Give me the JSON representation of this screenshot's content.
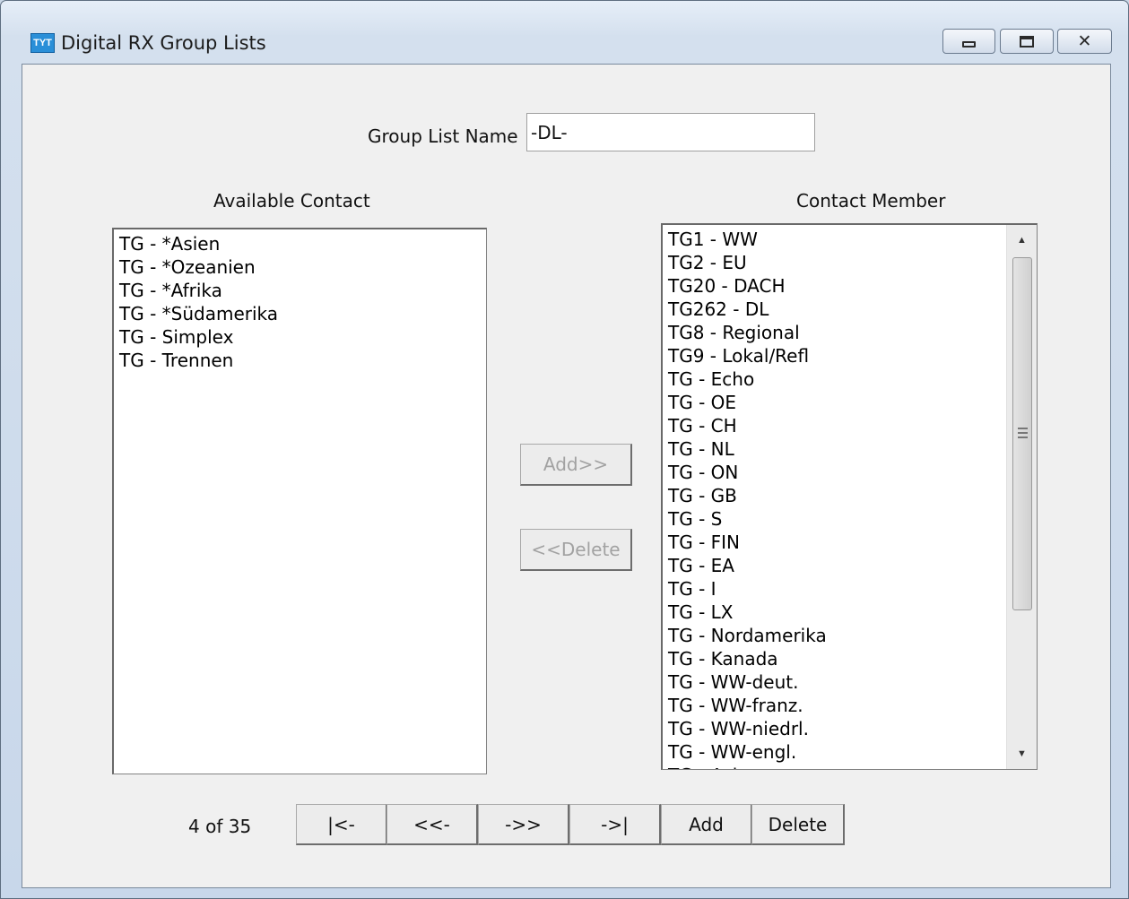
{
  "window": {
    "title": "Digital RX Group Lists",
    "app_icon_text": "TYT",
    "controls": [
      "minimize-icon",
      "maximize-icon",
      "close-icon"
    ]
  },
  "group_list_name": {
    "label": "Group List Name",
    "value": "-DL-"
  },
  "available": {
    "label": "Available Contact",
    "items": [
      "TG - *Asien",
      "TG - *Ozeanien",
      "TG - *Afrika",
      "TG - *Südamerika",
      "TG - Simplex",
      "TG - Trennen"
    ]
  },
  "member": {
    "label": "Contact Member",
    "items": [
      "TG1 - WW",
      "TG2 - EU",
      "TG20 - DACH",
      "TG262 - DL",
      "TG8 - Regional",
      "TG9 - Lokal/Refl",
      "TG - Echo",
      "TG - OE",
      "TG - CH",
      "TG - NL",
      "TG - ON",
      "TG - GB",
      "TG - S",
      "TG - FIN",
      "TG - EA",
      "TG - I",
      "TG - LX",
      "TG - Nordamerika",
      "TG - Kanada",
      "TG - WW-deut.",
      "TG - WW-franz.",
      "TG - WW-niedrl.",
      "TG - WW-engl.",
      "TG - Asien"
    ]
  },
  "transfer": {
    "add_label": "Add>>",
    "delete_label": "<<Delete"
  },
  "navigation": {
    "record_counter": "4 of 35",
    "first_label": "|<-",
    "prev_label": "<<-",
    "next_label": "->>",
    "last_label": "->|",
    "add_label": "Add",
    "delete_label": "Delete"
  }
}
